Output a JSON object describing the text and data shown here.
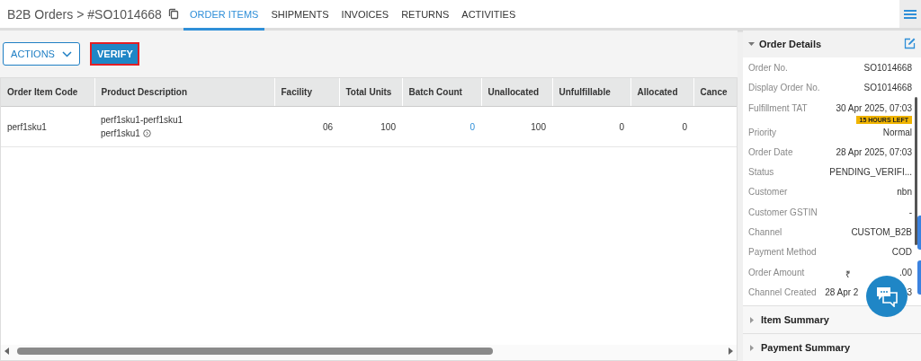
{
  "breadcrumb": {
    "parent": "B2B Orders",
    "separator": ">",
    "current": "#SO1014668"
  },
  "tabs": [
    {
      "label": "ORDER ITEMS",
      "selected": true
    },
    {
      "label": "SHIPMENTS",
      "selected": false
    },
    {
      "label": "INVOICES",
      "selected": false
    },
    {
      "label": "RETURNS",
      "selected": false
    },
    {
      "label": "ACTIVITIES",
      "selected": false
    }
  ],
  "toolbar": {
    "actions": "ACTIONS",
    "verify": "VERIFY"
  },
  "table": {
    "columns": [
      "Order Item Code",
      "Product Description",
      "Facility",
      "Total Units",
      "Batch Count",
      "Unallocated",
      "Unfulfillable",
      "Allocated",
      "Cance"
    ],
    "rows": [
      {
        "cells": [
          "perf1sku1",
          [
            "perf1sku1-perf1sku1",
            "perf1sku1"
          ],
          "06",
          "100",
          "0",
          "100",
          "0",
          "0",
          ""
        ]
      }
    ]
  },
  "order_details": {
    "title": "Order Details",
    "expanded": true,
    "fields": [
      {
        "label": "Order No.",
        "value": [
          "SO1014668"
        ]
      },
      {
        "label": "Display Order No.",
        "value": [
          "SO1014668"
        ]
      },
      {
        "label": "Fulfillment TAT",
        "value": [
          "30 Apr 2025, 07:03"
        ],
        "badge": "15 HOURS LEFT"
      },
      {
        "label": "Priority",
        "value": [
          "Normal"
        ]
      },
      {
        "label": "Order Date",
        "value": [
          "28 Apr 2025, 07:03"
        ]
      },
      {
        "label": "Status",
        "value": [
          "PENDING_VERIFI..."
        ]
      },
      {
        "label": "Customer",
        "value": [
          "nbn"
        ]
      },
      {
        "label": "Customer GSTIN",
        "value": [
          "-"
        ]
      },
      {
        "label": "Channel",
        "value": [
          "CUSTOM_B2B"
        ]
      },
      {
        "label": "Payment Method",
        "value": [
          "COD"
        ]
      },
      {
        "label": "Order Amount",
        "value": [
          "₹",
          ".00"
        ]
      },
      {
        "label": "Channel Created",
        "value": [
          "28 Apr 2",
          "3"
        ]
      }
    ]
  },
  "sections": [
    {
      "title": "Item Summary",
      "expanded": false
    },
    {
      "title": "Payment Summary",
      "expanded": false
    }
  ]
}
